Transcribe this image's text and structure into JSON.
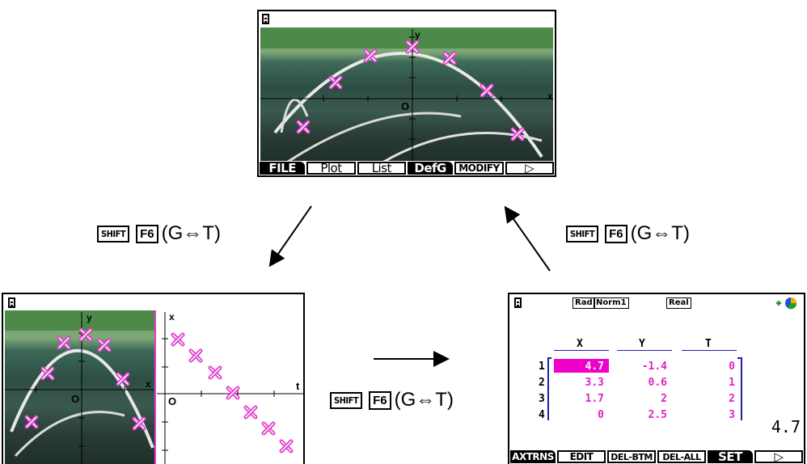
{
  "top_screen": {
    "axis_y": "y",
    "axis_x": "x",
    "origin": "O",
    "fkeys": [
      "FILE",
      "Plot",
      "List",
      "DefG",
      "MODIFY",
      "▷"
    ]
  },
  "left_screen": {
    "axis_y": "y",
    "axis_x": "x",
    "origin": "O",
    "right_axis_x": "x",
    "right_axis_t": "t",
    "right_origin": "O"
  },
  "right_screen": {
    "status": [
      "Rad",
      "Norm1",
      "Real"
    ],
    "columns": [
      "X",
      "Y",
      "T"
    ],
    "row_numbers": [
      "1",
      "2",
      "3",
      "4"
    ],
    "rows": [
      [
        "4.7",
        "-1.4",
        "0"
      ],
      [
        "3.3",
        "0.6",
        "1"
      ],
      [
        "1.7",
        "2",
        "2"
      ],
      [
        "0",
        "2.5",
        "3"
      ]
    ],
    "current_value": "4.7",
    "fkeys": [
      "AXTRNS",
      "EDIT",
      "DEL-BTM",
      "DEL-ALL",
      "SET",
      "▷"
    ]
  },
  "transitions": [
    {
      "key1": "SHIFT",
      "key2": "F6",
      "desc": "(G⇔T)"
    },
    {
      "key1": "SHIFT",
      "key2": "F6",
      "desc": "(G⇔T)"
    },
    {
      "key1": "SHIFT",
      "key2": "F6",
      "desc": "(G⇔T)"
    }
  ],
  "colors": {
    "marker": "#e040d0",
    "table_value": "#e020c8",
    "highlight": "#f000c8"
  }
}
